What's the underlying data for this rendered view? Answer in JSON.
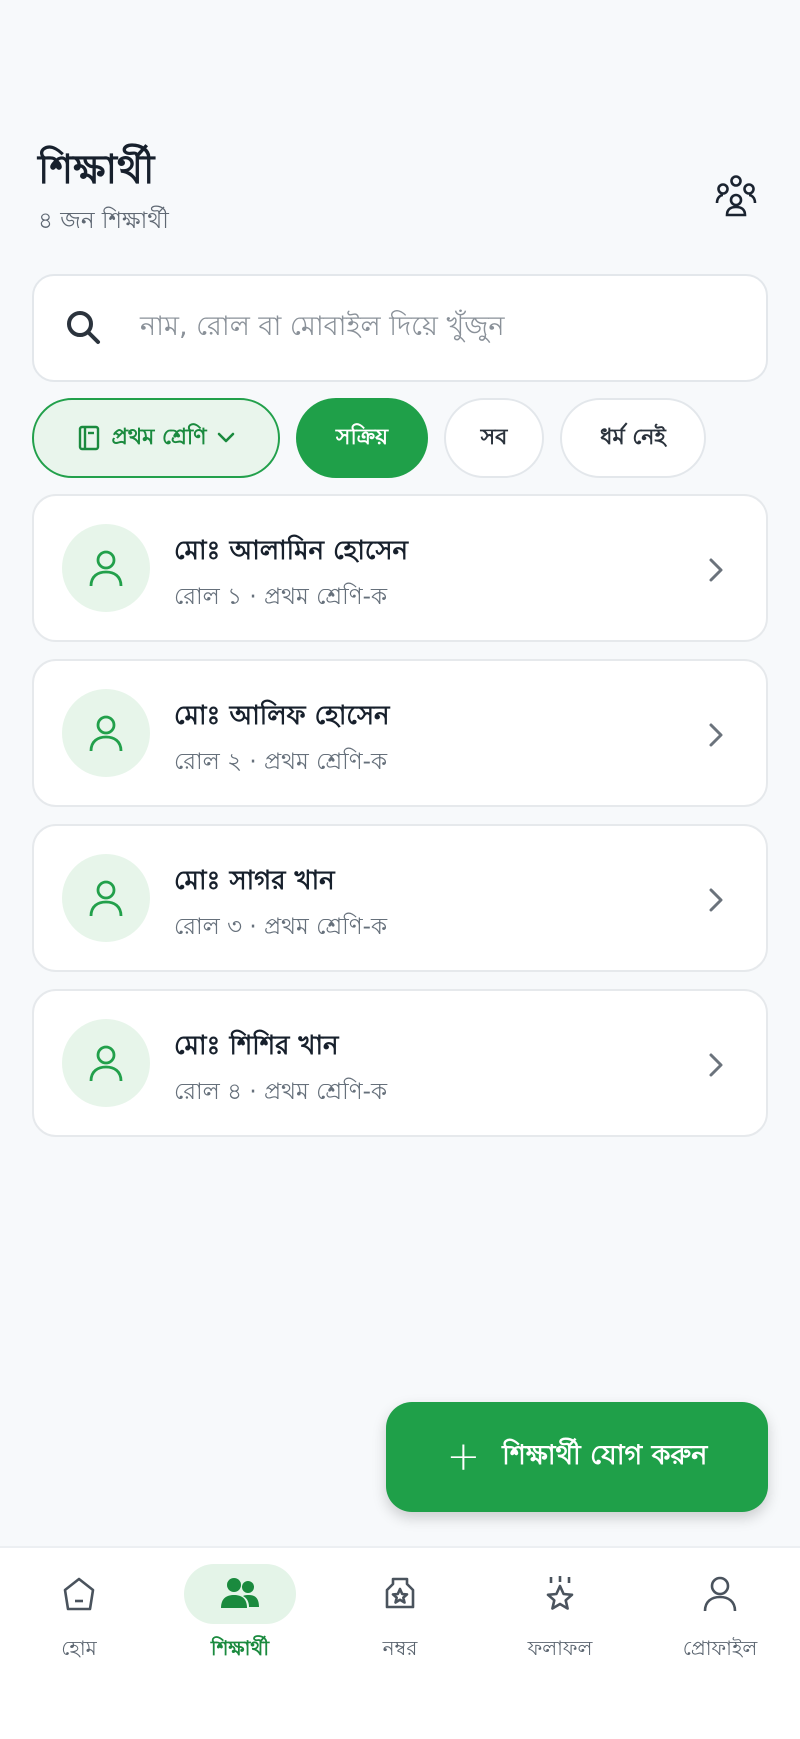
{
  "header": {
    "title": "শিক্ষার্থী",
    "subtitle": "৪ জন শিক্ষার্থী"
  },
  "search": {
    "placeholder": "নাম, রোল বা মোবাইল দিয়ে খুঁজুন"
  },
  "filters": {
    "class_label": "প্রথম শ্রেণি",
    "active_label": "সক্রিয়",
    "all_label": "সব",
    "no_religion_label": "ধর্ম নেই"
  },
  "students": [
    {
      "name": "মোঃ আলামিন হোসেন",
      "meta": "রোল ১ · প্রথম শ্রেণি-ক"
    },
    {
      "name": "মোঃ আলিফ হোসেন",
      "meta": "রোল ২ · প্রথম শ্রেণি-ক"
    },
    {
      "name": "মোঃ সাগর খান",
      "meta": "রোল ৩ · প্রথম শ্রেণি-ক"
    },
    {
      "name": "মোঃ শিশির খান",
      "meta": "রোল ৪ · প্রথম শ্রেণি-ক"
    }
  ],
  "fab": {
    "label": "শিক্ষার্থী যোগ করুন"
  },
  "nav": [
    {
      "label": "হোম",
      "icon": "home-icon"
    },
    {
      "label": "শিক্ষার্থী",
      "icon": "students-icon"
    },
    {
      "label": "নম্বর",
      "icon": "marks-icon"
    },
    {
      "label": "ফলাফল",
      "icon": "results-icon"
    },
    {
      "label": "প্রোফাইল",
      "icon": "profile-icon"
    }
  ],
  "colors": {
    "accent": "#1fa049",
    "accent_light": "#e7f5ea",
    "background": "#f7f9fb"
  }
}
